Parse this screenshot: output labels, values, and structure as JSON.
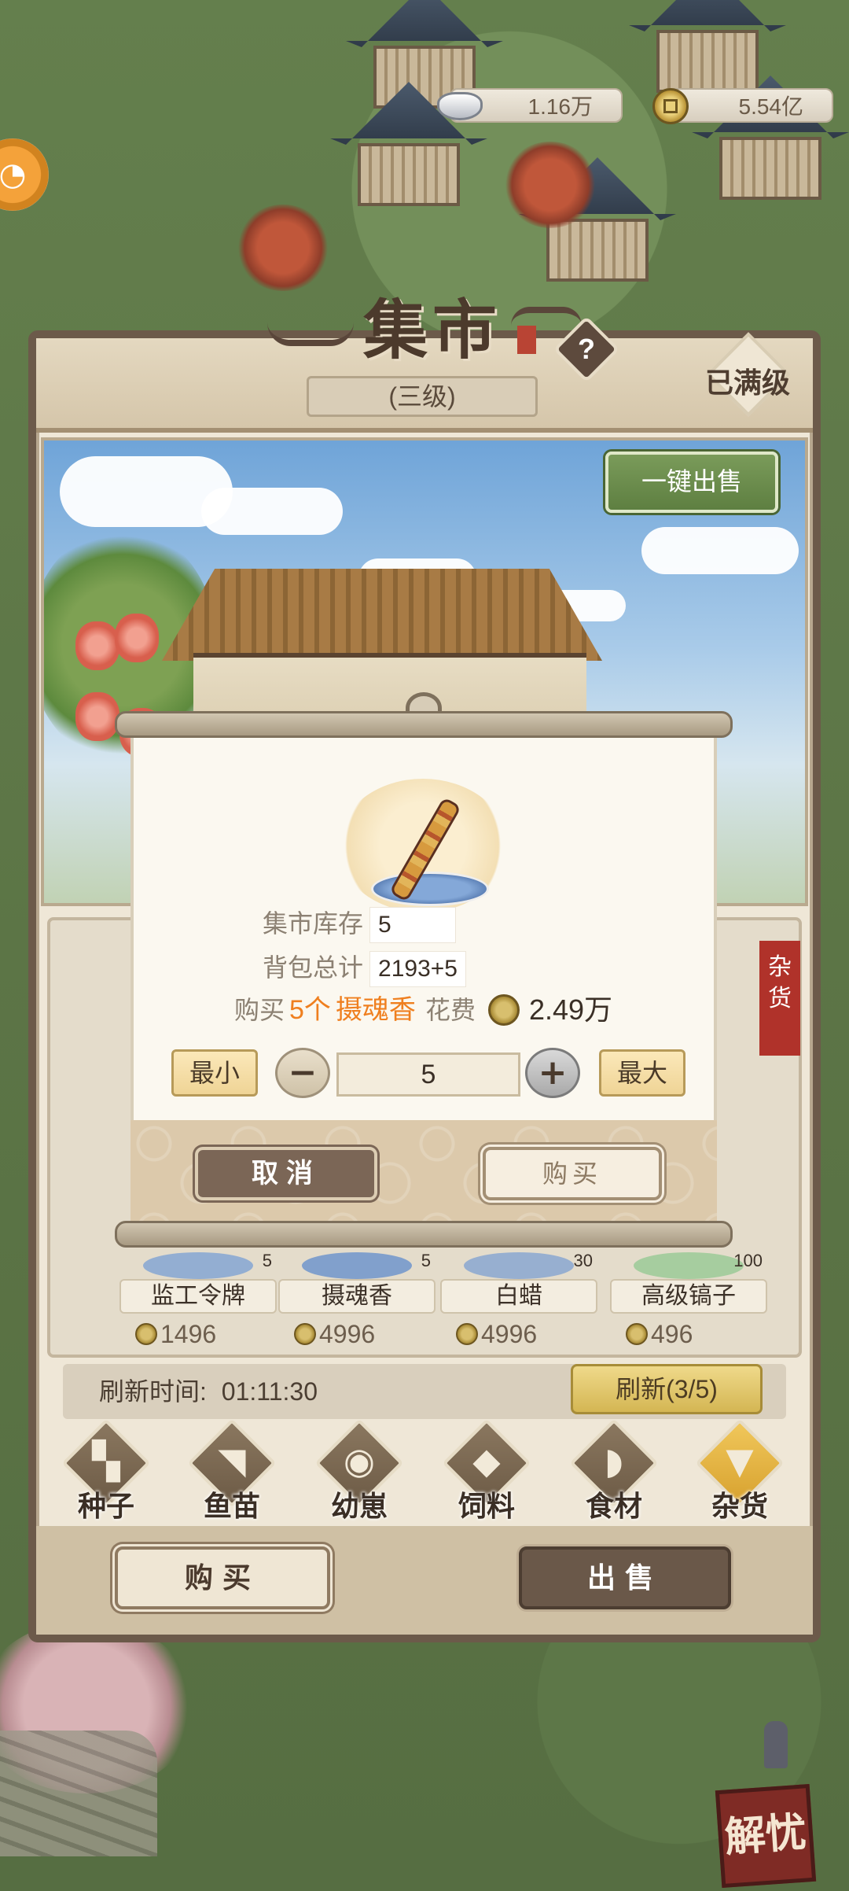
{
  "currency": {
    "silver": {
      "icon": "silver-ingot-icon",
      "value": "1.16万"
    },
    "gold": {
      "icon": "coin-icon",
      "value": "5.54亿"
    }
  },
  "panel": {
    "title": "集市",
    "level": "(三级)",
    "max_level": "已满级",
    "help": "?",
    "sell_all": "一键出售",
    "category_tag": "杂货"
  },
  "items": [
    {
      "name": "监工令牌",
      "stock": "5",
      "price": "1496"
    },
    {
      "name": "摄魂香",
      "stock": "5",
      "price": "4996"
    },
    {
      "name": "白蜡",
      "stock": "30",
      "price": "4996"
    },
    {
      "name": "高级镐子",
      "stock": "100",
      "price": "496"
    }
  ],
  "refresh": {
    "label": "刷新时间:",
    "time": "01:11:30",
    "button": "刷新(3/5)"
  },
  "categories": [
    {
      "label": "种子",
      "glyph": "▚"
    },
    {
      "label": "鱼苗",
      "glyph": "◥"
    },
    {
      "label": "幼崽",
      "glyph": "◉"
    },
    {
      "label": "饲料",
      "glyph": "◆"
    },
    {
      "label": "食材",
      "glyph": "◗"
    },
    {
      "label": "杂货",
      "glyph": "▼"
    }
  ],
  "footer": {
    "buy": "购买",
    "sell": "出售"
  },
  "modal": {
    "stock_label": "集市库存",
    "stock_value": "5",
    "bag_label": "背包总计",
    "bag_value": "2193+5",
    "buy_prefix": "购买",
    "buy_qty_text": "5个",
    "item_name": "摄魂香",
    "cost_label": "花费",
    "cost_value": "2.49万",
    "min": "最小",
    "minus": "−",
    "quantity": "5",
    "plus": "+",
    "max": "最大",
    "cancel": "取消",
    "confirm": "购买"
  },
  "worry_button": "解忧",
  "colors": {
    "panel_border": "#6c5a4a",
    "accent_orange": "#ef7f1f",
    "sell_green": "#5e7f41",
    "category_red": "#b0322a"
  }
}
